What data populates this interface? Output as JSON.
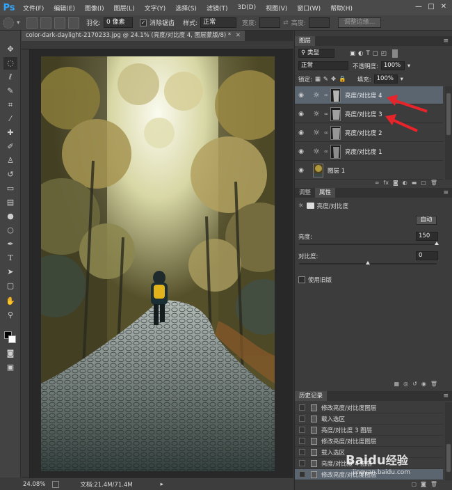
{
  "app": {
    "logo": "Ps",
    "accent": "#31a8ff"
  },
  "menu": [
    "文件(F)",
    "编辑(E)",
    "图像(I)",
    "图层(L)",
    "文字(Y)",
    "选择(S)",
    "滤镜(T)",
    "3D(D)",
    "视图(V)",
    "窗口(W)",
    "帮助(H)"
  ],
  "window_controls": [
    "—",
    "□",
    "✕"
  ],
  "options": {
    "feather_label": "羽化:",
    "feather_value": "0 像素",
    "antialias_label": "消除锯齿",
    "style_label": "样式:",
    "style_value": "正常",
    "width_label": "宽度:",
    "height_label": "高度:",
    "refine_button": "调整边缘..."
  },
  "tools": [
    "move-tool",
    "marquee-tool",
    "lasso-tool",
    "quick-select-tool",
    "crop-tool",
    "eyedropper-tool",
    "healing-tool",
    "brush-tool",
    "clone-stamp-tool",
    "history-brush-tool",
    "eraser-tool",
    "gradient-tool",
    "blur-tool",
    "dodge-tool",
    "pen-tool",
    "type-tool",
    "path-select-tool",
    "shape-tool",
    "hand-tool",
    "zoom-tool"
  ],
  "document": {
    "tab_title": "color-dark-daylight-2170233.jpg @ 24.1% (亮度/对比度 4, 图层蒙版/8) *",
    "zoom": "24.08%",
    "doc_info": "文档:21.4M/71.4M"
  },
  "layers_panel": {
    "tab": "图层",
    "filter_value": "类型",
    "blend_mode": "正常",
    "opacity_label": "不透明度:",
    "opacity_value": "100%",
    "lock_label": "锁定:",
    "fill_label": "填充:",
    "fill_value": "100%",
    "layers": [
      {
        "name": "亮度/对比度 4",
        "type": "adjustment",
        "selected": true
      },
      {
        "name": "亮度/对比度 3",
        "type": "adjustment",
        "selected": false
      },
      {
        "name": "亮度/对比度 2",
        "type": "adjustment",
        "selected": false
      },
      {
        "name": "亮度/对比度 1",
        "type": "adjustment",
        "selected": false
      },
      {
        "name": "图层 1",
        "type": "image",
        "selected": false
      }
    ],
    "footer_icons": [
      "link-icon",
      "fx-icon",
      "mask-icon",
      "adjustment-icon",
      "group-icon",
      "new-layer-icon",
      "trash-icon"
    ]
  },
  "properties_panel": {
    "tabs": [
      "调整",
      "属性"
    ],
    "title": "亮度/对比度",
    "auto_button": "自动",
    "brightness_label": "亮度:",
    "brightness_value": "150",
    "brightness_level": 1.0,
    "contrast_label": "对比度:",
    "contrast_value": "0",
    "contrast_level": 0.5,
    "legacy_label": "使用旧版"
  },
  "history_panel": {
    "tab": "历史记录",
    "items": [
      {
        "label": "修改亮度/对比度图层",
        "selected": false
      },
      {
        "label": "载入选区",
        "selected": false
      },
      {
        "label": "亮度/对比度 3 图层",
        "selected": false
      },
      {
        "label": "修改亮度/对比度图层",
        "selected": false
      },
      {
        "label": "载入选区",
        "selected": false
      },
      {
        "label": "亮度/对比度 4 图层",
        "selected": false
      },
      {
        "label": "修改亮度/对比度图层",
        "selected": true
      }
    ]
  },
  "watermark": {
    "brand": "Baidu",
    "brand_cn": "经验",
    "url": "jingyan.baidu.com"
  },
  "colors": {
    "arrow": "#e8232a",
    "selected_row": "#5a6570"
  }
}
